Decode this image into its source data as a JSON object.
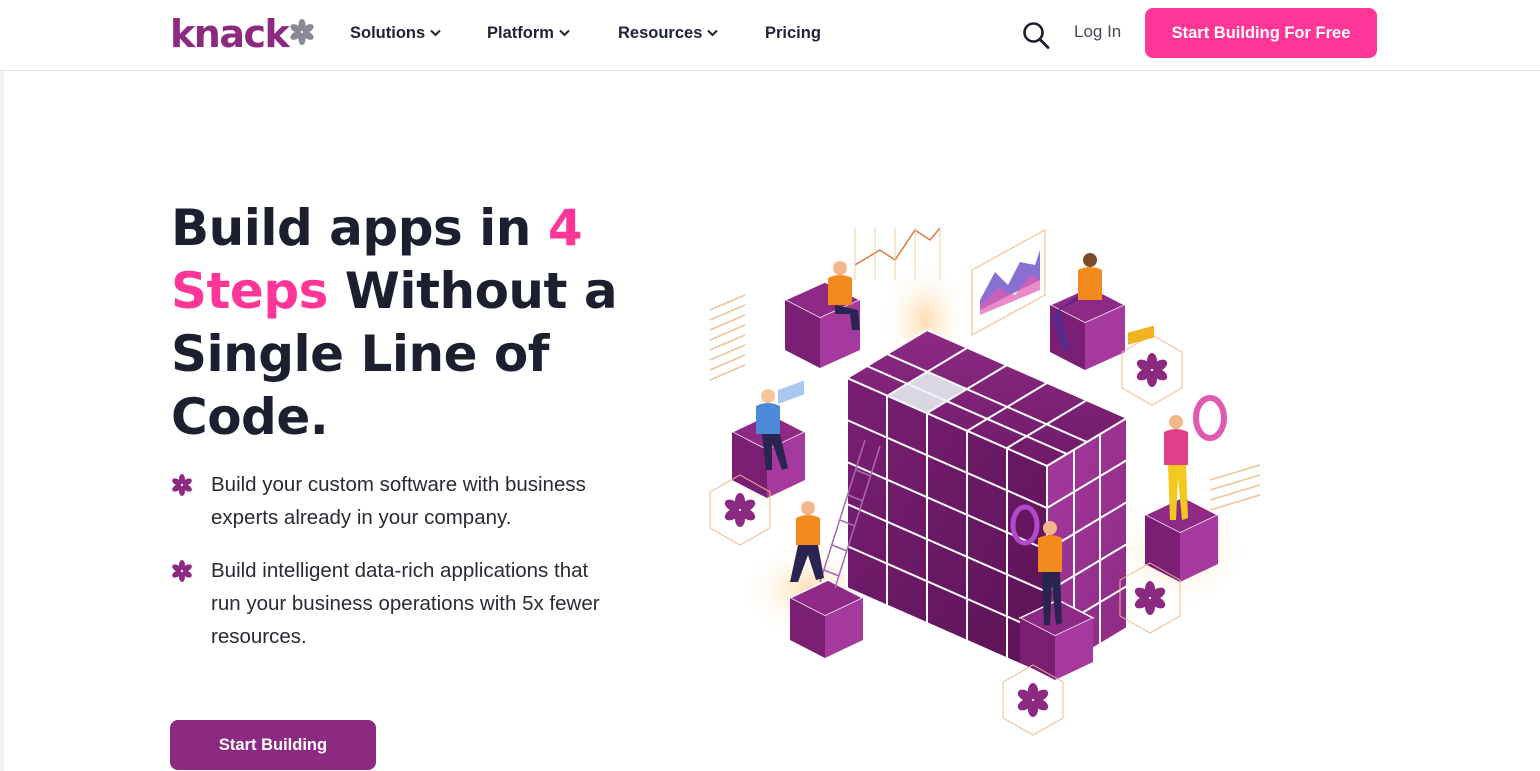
{
  "brand": {
    "logo_text": "knack",
    "logo_icon": "asterisk-logo-icon",
    "primary_color": "#8c2a82",
    "accent_color": "#ff3598"
  },
  "nav": {
    "items": [
      {
        "label": "Solutions",
        "icon": "chevron-down-icon"
      },
      {
        "label": "Platform",
        "icon": "chevron-down-icon"
      },
      {
        "label": "Resources",
        "icon": "chevron-down-icon"
      },
      {
        "label": "Pricing"
      }
    ],
    "search_icon": "search-icon",
    "login_label": "Log In",
    "cta_label": "Start Building For Free"
  },
  "hero": {
    "title_part1": "Build apps in ",
    "title_highlight1": "4",
    "title_highlight2": "Steps",
    "title_part2": " Without a Single Line of Code.",
    "bullets": [
      {
        "icon": "asterisk-bullet-icon",
        "text": "Build your custom software with business experts already in your company."
      },
      {
        "icon": "asterisk-bullet-icon",
        "text": "Build intelligent data-rich applications that run your business operations with 5x fewer resources."
      }
    ],
    "cta_label": "Start Building"
  },
  "illustration": {
    "icon": "isometric-cube-illustration"
  }
}
